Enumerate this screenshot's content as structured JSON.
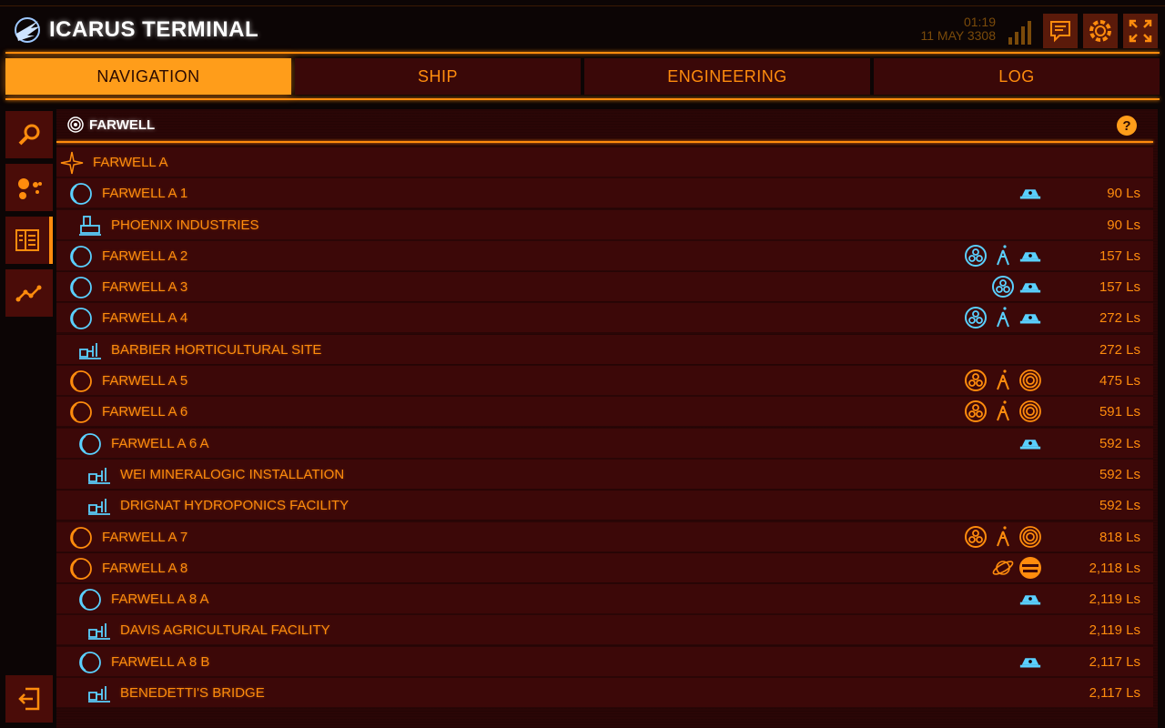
{
  "app": {
    "title": "ICARUS TERMINAL"
  },
  "clock": {
    "time": "01:19",
    "date": "11 MAY 3308"
  },
  "colors": {
    "accent": "#ff8c0d",
    "blue": "#5ad0ff",
    "panel": "#3c0808"
  },
  "tabs": [
    {
      "label": "NAVIGATION",
      "active": true
    },
    {
      "label": "SHIP",
      "active": false
    },
    {
      "label": "ENGINEERING",
      "active": false
    },
    {
      "label": "LOG",
      "active": false
    }
  ],
  "sidebar": {
    "items": [
      {
        "icon": "search-icon"
      },
      {
        "icon": "system-map-icon"
      },
      {
        "icon": "list-view-icon",
        "active": true
      },
      {
        "icon": "route-icon"
      }
    ],
    "exit_icon": "exit-icon"
  },
  "system": {
    "name": "FARWELL",
    "help_label": "?"
  },
  "bodies": [
    {
      "name": "FARWELL A",
      "type": "star",
      "indent": 0,
      "badges": [],
      "distance": ""
    },
    {
      "name": "FARWELL A 1",
      "type": "moon-blue",
      "indent": 1,
      "badges": [
        "station"
      ],
      "distance": "90 Ls"
    },
    {
      "name": "PHOENIX INDUSTRIES",
      "type": "outpost",
      "indent": 2,
      "badges": [],
      "distance": "90 Ls"
    },
    {
      "name": "FARWELL A 2",
      "type": "moon-blue",
      "indent": 1,
      "badges": [
        "geo",
        "bio",
        "station"
      ],
      "distance": "157 Ls"
    },
    {
      "name": "FARWELL A 3",
      "type": "moon-blue",
      "indent": 1,
      "badges": [
        "geo",
        "station"
      ],
      "distance": "157 Ls"
    },
    {
      "name": "FARWELL A 4",
      "type": "moon-blue",
      "indent": 1,
      "badges": [
        "geo",
        "bio",
        "station"
      ],
      "distance": "272 Ls"
    },
    {
      "name": "BARBIER HORTICULTURAL SITE",
      "type": "settlement",
      "indent": 2,
      "badges": [],
      "distance": "272 Ls"
    },
    {
      "name": "FARWELL A 5",
      "type": "moon-orange",
      "indent": 1,
      "badges": [
        "geo-o",
        "bio-o",
        "rings-o"
      ],
      "distance": "475 Ls"
    },
    {
      "name": "FARWELL A 6",
      "type": "moon-orange",
      "indent": 1,
      "badges": [
        "geo-o",
        "bio-o",
        "rings-o"
      ],
      "distance": "591 Ls"
    },
    {
      "name": "FARWELL A 6 A",
      "type": "moon-blue",
      "indent": 2,
      "badges": [
        "station"
      ],
      "distance": "592 Ls"
    },
    {
      "name": "WEI MINERALOGIC INSTALLATION",
      "type": "settlement",
      "indent": 3,
      "badges": [],
      "distance": "592 Ls"
    },
    {
      "name": "DRIGNAT HYDROPONICS FACILITY",
      "type": "settlement",
      "indent": 3,
      "badges": [],
      "distance": "592 Ls"
    },
    {
      "name": "FARWELL A 7",
      "type": "moon-orange",
      "indent": 1,
      "badges": [
        "geo-o",
        "bio-o",
        "rings-o"
      ],
      "distance": "818 Ls"
    },
    {
      "name": "FARWELL A 8",
      "type": "moon-orange",
      "indent": 1,
      "badges": [
        "planet-o",
        "gasgiant-o"
      ],
      "distance": "2,118 Ls"
    },
    {
      "name": "FARWELL A 8 A",
      "type": "moon-blue",
      "indent": 2,
      "badges": [
        "station"
      ],
      "distance": "2,119 Ls"
    },
    {
      "name": "DAVIS AGRICULTURAL FACILITY",
      "type": "settlement",
      "indent": 3,
      "badges": [],
      "distance": "2,119 Ls"
    },
    {
      "name": "FARWELL A 8 B",
      "type": "moon-blue",
      "indent": 2,
      "badges": [
        "station"
      ],
      "distance": "2,117 Ls"
    },
    {
      "name": "BENEDETTI'S BRIDGE",
      "type": "settlement",
      "indent": 3,
      "badges": [],
      "distance": "2,117 Ls"
    }
  ]
}
